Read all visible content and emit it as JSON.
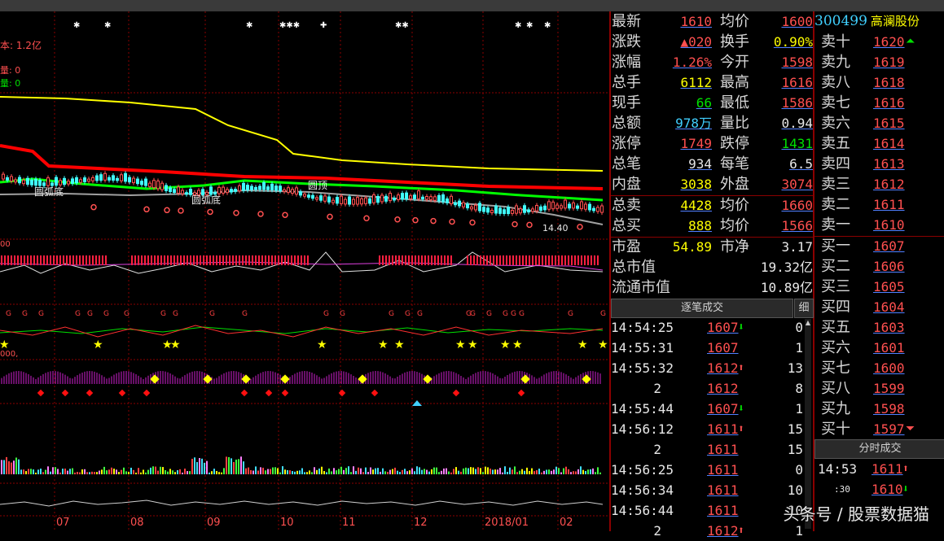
{
  "chart_labels": {
    "cost": "本: 1.2亿",
    "vol1": "量: 0",
    "vol2": "量: 0",
    "pattern1": "圆弧底",
    "pattern2": "圆弧底",
    "pattern3": "圆顶",
    "price_label": "14.40",
    "axis_num": "00",
    "sub_num": "000,",
    "x_ticks": [
      "07",
      "08",
      "09",
      "10",
      "11",
      "12",
      "2018/01",
      "02"
    ]
  },
  "stock": {
    "code": "300499",
    "name": "高澜股份"
  },
  "quote": [
    {
      "l1": "最新",
      "v1": "1610",
      "c1": "red",
      "l2": "均价",
      "v2": "1600",
      "c2": "red"
    },
    {
      "l1": "涨跌",
      "v1": "▲020",
      "c1": "red",
      "l2": "换手",
      "v2": "0.90%",
      "c2": "yellow"
    },
    {
      "l1": "涨幅",
      "v1": "1.26%",
      "c1": "red",
      "l2": "今开",
      "v2": "1598",
      "c2": "red"
    },
    {
      "l1": "总手",
      "v1": "6112",
      "c1": "yellow",
      "l2": "最高",
      "v2": "1616",
      "c2": "red"
    },
    {
      "l1": "现手",
      "v1": "66",
      "c1": "green",
      "l2": "最低",
      "v2": "1586",
      "c2": "red"
    },
    {
      "l1": "总额",
      "v1": "978万",
      "c1": "cyan",
      "l2": "量比",
      "v2": "0.94",
      "c2": "white"
    },
    {
      "l1": "涨停",
      "v1": "1749",
      "c1": "red",
      "l2": "跌停",
      "v2": "1431",
      "c2": "green"
    },
    {
      "l1": "总笔",
      "v1": "934",
      "c1": "white",
      "l2": "每笔",
      "v2": "6.5",
      "c2": "white"
    },
    {
      "l1": "内盘",
      "v1": "3038",
      "c1": "yellow",
      "l2": "外盘",
      "v2": "3074",
      "c2": "red"
    }
  ],
  "totals": [
    {
      "l1": "总卖",
      "v1": "4428",
      "c1": "yellow",
      "l2": "均价",
      "v2": "1660",
      "c2": "red"
    },
    {
      "l1": "总买",
      "v1": "888",
      "c1": "yellow",
      "l2": "均价",
      "v2": "1566",
      "c2": "red"
    }
  ],
  "valuation": [
    {
      "l": "市盈",
      "v": "54.89",
      "c": "yellow",
      "l2": "市净",
      "v2": "3.17"
    },
    {
      "l": "总市值",
      "v": "19.32亿"
    },
    {
      "l": "流通市值",
      "v": "10.89亿"
    }
  ],
  "trades_header": {
    "title": "逐笔成交",
    "detail": "细"
  },
  "trades": [
    {
      "t": "14:54:25",
      "p": "1607",
      "a": "⬇",
      "ac": "green",
      "v": "0"
    },
    {
      "t": "14:55:31",
      "p": "1607",
      "a": "",
      "ac": "",
      "v": "1"
    },
    {
      "t": "14:55:32",
      "p": "1612",
      "a": "⬆",
      "ac": "red",
      "v": "13"
    },
    {
      "t": "2",
      "p": "1612",
      "a": "",
      "ac": "",
      "v": "8"
    },
    {
      "t": "14:55:44",
      "p": "1607",
      "a": "⬇",
      "ac": "green",
      "v": "1"
    },
    {
      "t": "14:56:12",
      "p": "1611",
      "a": "⬆",
      "ac": "red",
      "v": "15"
    },
    {
      "t": "2",
      "p": "1611",
      "a": "",
      "ac": "",
      "v": "15"
    },
    {
      "t": "14:56:25",
      "p": "1611",
      "a": "",
      "ac": "",
      "v": "0"
    },
    {
      "t": "14:56:34",
      "p": "1611",
      "a": "",
      "ac": "",
      "v": "10"
    },
    {
      "t": "14:56:44",
      "p": "1611",
      "a": "",
      "ac": "",
      "v": "10"
    },
    {
      "t": "2",
      "p": "1612",
      "a": "⬆",
      "ac": "red",
      "v": "1"
    }
  ],
  "sell": [
    {
      "l": "卖十",
      "p": "1620",
      "x": "⏶"
    },
    {
      "l": "卖九",
      "p": "1619",
      "x": ""
    },
    {
      "l": "卖八",
      "p": "1618",
      "x": ""
    },
    {
      "l": "卖七",
      "p": "1616",
      "x": ""
    },
    {
      "l": "卖六",
      "p": "1615",
      "x": ""
    },
    {
      "l": "卖五",
      "p": "1614",
      "x": ""
    },
    {
      "l": "卖四",
      "p": "1613",
      "x": ""
    },
    {
      "l": "卖三",
      "p": "1612",
      "x": ""
    },
    {
      "l": "卖二",
      "p": "1611",
      "x": ""
    },
    {
      "l": "卖一",
      "p": "1610",
      "x": ""
    }
  ],
  "buy": [
    {
      "l": "买一",
      "p": "1607",
      "x": ""
    },
    {
      "l": "买二",
      "p": "1606",
      "x": ""
    },
    {
      "l": "买三",
      "p": "1605",
      "x": ""
    },
    {
      "l": "买四",
      "p": "1604",
      "x": ""
    },
    {
      "l": "买五",
      "p": "1603",
      "x": ""
    },
    {
      "l": "买六",
      "p": "1601",
      "x": ""
    },
    {
      "l": "买七",
      "p": "1600",
      "x": ""
    },
    {
      "l": "买八",
      "p": "1599",
      "x": ""
    },
    {
      "l": "买九",
      "p": "1598",
      "x": ""
    },
    {
      "l": "买十",
      "p": "1597",
      "x": "⏷"
    }
  ],
  "minute_header": {
    "title": "分时成交"
  },
  "minute_trades": [
    {
      "t": "14:53",
      "p": "1611",
      "a": "⬆",
      "ac": "red"
    },
    {
      "t": ":30",
      "p": "1610",
      "a": "⬇",
      "ac": "green"
    }
  ],
  "watermark": "头条号 / 股票数据猫",
  "colors": {
    "bg": "#000000",
    "grid": "#8b0000",
    "up": "#ff5050",
    "down": "#00e000",
    "ma_yellow": "#ffff00",
    "ma_red": "#ff0000",
    "ma_green": "#00ff00"
  }
}
